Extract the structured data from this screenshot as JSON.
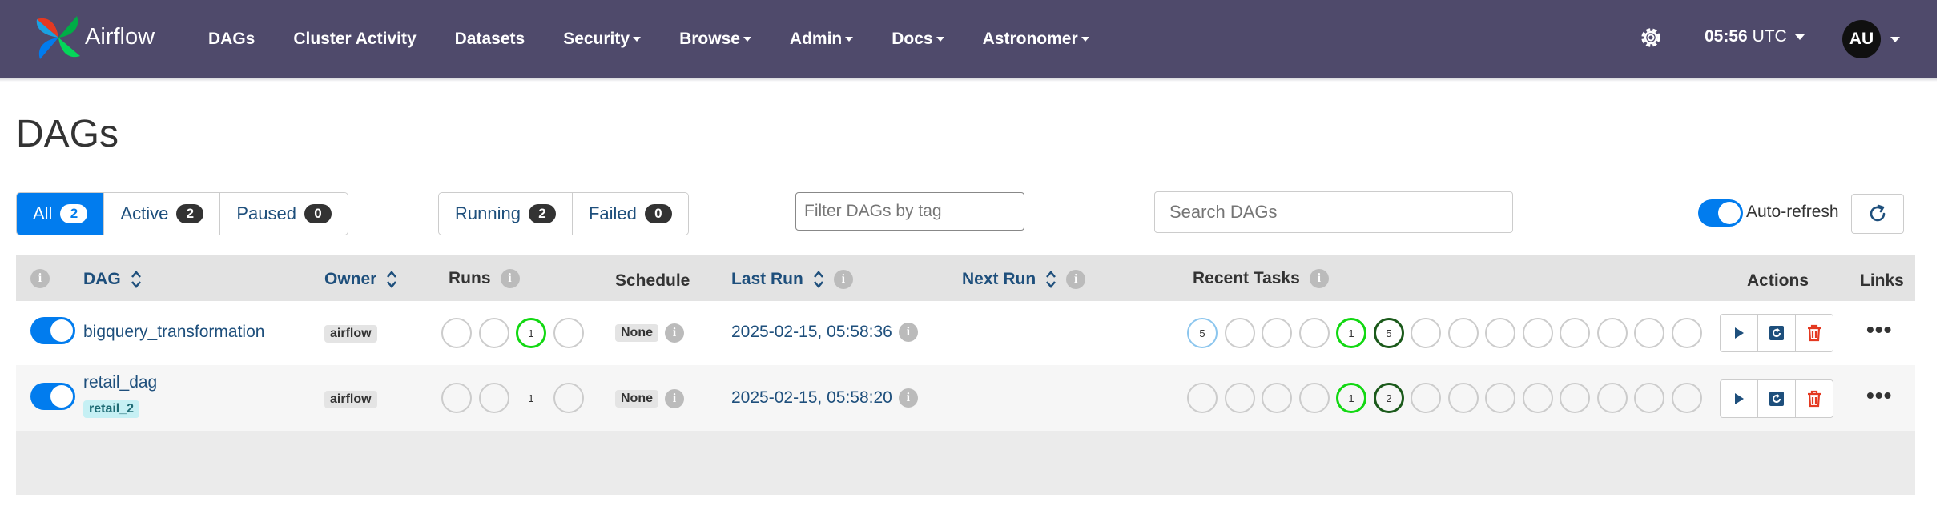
{
  "brand": "Airflow",
  "nav": {
    "items": [
      {
        "label": "DAGs",
        "dropdown": false
      },
      {
        "label": "Cluster Activity",
        "dropdown": false
      },
      {
        "label": "Datasets",
        "dropdown": false
      },
      {
        "label": "Security",
        "dropdown": true
      },
      {
        "label": "Browse",
        "dropdown": true
      },
      {
        "label": "Admin",
        "dropdown": true
      },
      {
        "label": "Docs",
        "dropdown": true
      },
      {
        "label": "Astronomer",
        "dropdown": true
      }
    ],
    "time": "05:56",
    "timezone": "UTC",
    "avatar": "AU"
  },
  "page": {
    "title": "DAGs"
  },
  "status_filter": [
    {
      "label": "All",
      "count": "2",
      "active": true
    },
    {
      "label": "Active",
      "count": "2",
      "active": false
    },
    {
      "label": "Paused",
      "count": "0",
      "active": false
    }
  ],
  "run_filter": [
    {
      "label": "Running",
      "count": "2"
    },
    {
      "label": "Failed",
      "count": "0"
    }
  ],
  "tag_filter": {
    "placeholder": "Filter DAGs by tag"
  },
  "search": {
    "placeholder": "Search DAGs"
  },
  "auto_refresh": {
    "label": "Auto-refresh",
    "on": true
  },
  "table": {
    "columns": {
      "dag": "DAG",
      "owner": "Owner",
      "runs": "Runs",
      "schedule": "Schedule",
      "last_run": "Last Run",
      "next_run": "Next Run",
      "recent_tasks": "Recent Tasks",
      "actions": "Actions",
      "links": "Links"
    },
    "rows": [
      {
        "dag_id": "bigquery_transformation",
        "tag": "",
        "owner": "airflow",
        "runs": [
          "",
          "",
          "1",
          ""
        ],
        "schedule": "None",
        "last_run": "2025-02-15, 05:58:36",
        "recent_tasks": [
          "5",
          "",
          "",
          "",
          "1",
          "5",
          "",
          "",
          "",
          "",
          "",
          "",
          "",
          ""
        ]
      },
      {
        "dag_id": "retail_dag",
        "tag": "retail_2",
        "owner": "airflow",
        "runs": [
          "",
          "",
          "1",
          ""
        ],
        "schedule": "None",
        "last_run": "2025-02-15, 05:58:20",
        "recent_tasks": [
          "",
          "",
          "",
          "",
          "1",
          "2",
          "",
          "",
          "",
          "",
          "",
          "",
          "",
          ""
        ]
      }
    ]
  },
  "colors": {
    "navbar": "#4f4a6b",
    "primary": "#017cee",
    "link": "#1e4f7c",
    "success": "#12d812",
    "delete": "#e43921"
  }
}
